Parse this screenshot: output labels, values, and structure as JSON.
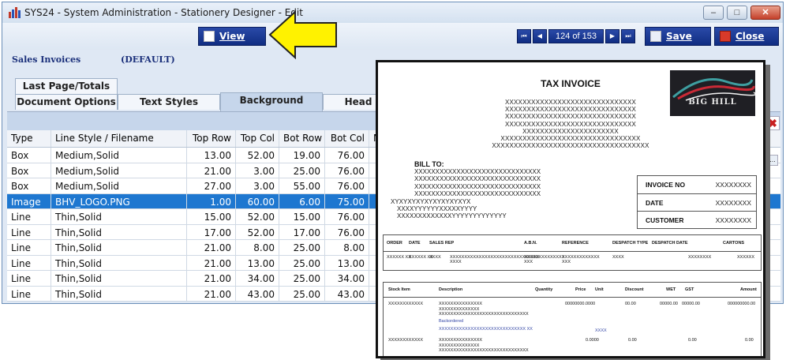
{
  "window": {
    "title": "SYS24 - System Administration - Stationery Designer - Edit",
    "min_glyph": "–",
    "max_glyph": "□",
    "close_glyph": "✕"
  },
  "toolbar": {
    "view_label": "View",
    "save_label": "Save",
    "close_label": "Close",
    "first_glyph": "⏮",
    "prev_glyph": "◀",
    "next_glyph": "▶",
    "last_glyph": "⏭",
    "record_position": "124 of 153"
  },
  "document": {
    "name": "Sales Invoices",
    "variant": "(DEFAULT)"
  },
  "tabs": {
    "row1": [
      "Last Page/Totals"
    ],
    "row2": [
      "Document Options",
      "Text Styles",
      "Background",
      "Head"
    ],
    "active": "Background"
  },
  "grid": {
    "columns": [
      "Type",
      "Line Style / Filename",
      "Top Row",
      "Top Col",
      "Bot Row",
      "Bot Col",
      "Mod"
    ],
    "rows": [
      [
        "Box",
        "Medium,Solid",
        "13.00",
        "52.00",
        "19.00",
        "76.00"
      ],
      [
        "Box",
        "Medium,Solid",
        "21.00",
        "3.00",
        "25.00",
        "76.00"
      ],
      [
        "Box",
        "Medium,Solid",
        "27.00",
        "3.00",
        "55.00",
        "76.00"
      ],
      [
        "Image",
        "BHV_LOGO.PNG",
        "1.00",
        "60.00",
        "6.00",
        "75.00"
      ],
      [
        "Line",
        "Thin,Solid",
        "15.00",
        "52.00",
        "15.00",
        "76.00"
      ],
      [
        "Line",
        "Thin,Solid",
        "17.00",
        "52.00",
        "17.00",
        "76.00"
      ],
      [
        "Line",
        "Thin,Solid",
        "21.00",
        "8.00",
        "25.00",
        "8.00"
      ],
      [
        "Line",
        "Thin,Solid",
        "21.00",
        "13.00",
        "25.00",
        "13.00"
      ],
      [
        "Line",
        "Thin,Solid",
        "21.00",
        "34.00",
        "25.00",
        "34.00"
      ],
      [
        "Line",
        "Thin,Solid",
        "21.00",
        "43.00",
        "25.00",
        "43.00"
      ]
    ],
    "selected_row": 3,
    "delete_glyph": "✖",
    "more_glyph": "..."
  },
  "preview": {
    "title": "TAX INVOICE",
    "logo_text": "BIG HILL",
    "address_lines": [
      "XXXXXXXXXXXXXXXXXXXXXXXXXXXXXX",
      "XXXXXXXXXXXXXXXXXXXXXXXXXXXXXX",
      "XXXXXXXXXXXXXXXXXXXXXXXXXXXXXX",
      "XXXXXXXXXXXXXXXXXXXXXXXXXXXXXX",
      "XXXXXXXXXXXXXXXXXXXXXX",
      "XXXXXXXXXXXXXXXXXXXXXXXXXXXXXXXX",
      "XXXXXXXXXXXXXXXXXXXXXXXXXXXXXXXXXXXX"
    ],
    "bill_to_label": "BILL TO:",
    "bill_lines": [
      "XXXXXXXXXXXXXXXXXXXXXXXXXXXXXX",
      "XXXXXXXXXXXXXXXXXXXXXXXXXXXXXX",
      "XXXXXXXXXXXXXXXXXXXXXXXXXXXXXX",
      "XXXXXXXXXXXXXXXXXXXXXXXXXXXXXX",
      "XYXYXYXYXYXYXYXYXYX",
      "XXXXYYYYYYXXXXXYYYY",
      "XXXXXXXXXXXXXYYYYYYYYYYYYY"
    ],
    "info": [
      {
        "label": "INVOICE NO",
        "value": "XXXXXXXX"
      },
      {
        "label": "DATE",
        "value": "XXXXXXXX"
      },
      {
        "label": "CUSTOMER",
        "value": "XXXXXXXX"
      }
    ],
    "order_headers": [
      "ORDER",
      "DATE",
      "SALES REP",
      "A.B.N.",
      "REFERENCE",
      "DESPATCH TYPE",
      "DESPATCH DATE",
      "CARTONS"
    ],
    "order_values": [
      "XXXXXX XX",
      "XXXXXX XX",
      "XXXX",
      "XXXXXXXXXXXXXXXXXXXXXXXXXXXXXXX XXXX",
      "XXXXXXXXXXXXXX XXX",
      "XXXXXXXXXXXXX XXX",
      "XXXX",
      "XXXXXXXX",
      "XXXXXX"
    ],
    "item_headers": [
      "Stock Item",
      "Description",
      "Quantity",
      "Price",
      "Unit",
      "Discount",
      "WET",
      "GST",
      "Amount"
    ],
    "item_row1": {
      "stock": "XXXXXXXXXXXX",
      "desc": [
        "XXXXXXXXXXXXXXX",
        "XXXXXXXXXXXXXX",
        "XXXXXXXXXXXXXXXXXXXXXXXXXXXXXXX"
      ],
      "price": "00000000.0000",
      "discount": "00.00",
      "wet": "00000.00",
      "gst": "00000.00",
      "amount": "000000000.00"
    },
    "backordered_label": "Backordered",
    "backordered_line": "XXXXXXXXXXXXXXXXXXXXXXXXXXXXXX XX",
    "item_row2": {
      "stock": "XXXXXXXXXXXX",
      "desc": [
        "XXXXXXXXXXXXXXX",
        "XXXXXXXXXXXXXX",
        "XXXXXXXXXXXXXXXXXXXXXXXXXXXXXXX"
      ],
      "unit": "XXXX",
      "price": "0.0000",
      "discount": "0.00",
      "gst": "0.00",
      "amount": "0.00"
    }
  }
}
